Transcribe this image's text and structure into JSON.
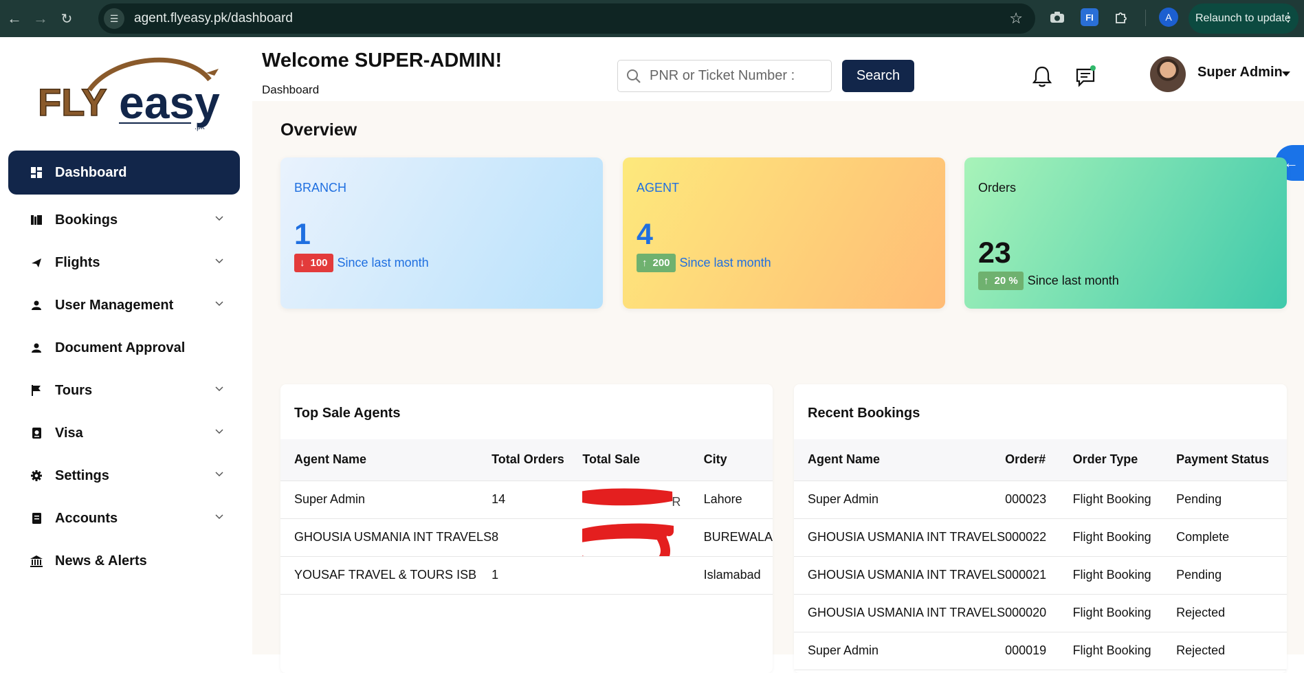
{
  "browser": {
    "url": "agent.flyeasy.pk/dashboard",
    "relaunch_label": "Relaunch to update",
    "profile_initial": "A",
    "extension_label": "FI"
  },
  "sidebar": {
    "logo_text_fly": "FLY",
    "logo_text_easy": "easy",
    "logo_text_tld": ".pk",
    "items": [
      {
        "label": "Dashboard",
        "icon": "dashboard-icon",
        "active": true,
        "expandable": false
      },
      {
        "label": "Bookings",
        "icon": "bookings-icon",
        "expandable": true
      },
      {
        "label": "Flights",
        "icon": "plane-icon",
        "expandable": true
      },
      {
        "label": "User Management",
        "icon": "user-icon",
        "expandable": true
      },
      {
        "label": "Document Approval",
        "icon": "user-icon",
        "expandable": false
      },
      {
        "label": "Tours",
        "icon": "flag-icon",
        "expandable": true
      },
      {
        "label": "Visa",
        "icon": "passport-icon",
        "expandable": true
      },
      {
        "label": "Settings",
        "icon": "gear-icon",
        "expandable": true
      },
      {
        "label": "Accounts",
        "icon": "ledger-icon",
        "expandable": true
      },
      {
        "label": "News & Alerts",
        "icon": "bank-icon",
        "expandable": false
      }
    ]
  },
  "header": {
    "welcome": "Welcome SUPER-ADMIN!",
    "breadcrumb": "Dashboard",
    "search_placeholder": "PNR or Ticket Number :",
    "search_button": "Search",
    "user_name": "Super Admin"
  },
  "overview": {
    "title": "Overview",
    "cards": [
      {
        "label": "BRANCH",
        "value": "1",
        "trend": "down",
        "badge": "100",
        "since": "Since last month"
      },
      {
        "label": "AGENT",
        "value": "4",
        "trend": "up",
        "badge": "200",
        "since": "Since last month"
      },
      {
        "label": "Orders",
        "value": "23",
        "trend": "up",
        "badge": "20 %",
        "since": "Since last month"
      }
    ]
  },
  "top_sale_agents": {
    "title": "Top Sale Agents",
    "columns": [
      "Agent Name",
      "Total Orders",
      "Total Sale",
      "City"
    ],
    "rows": [
      {
        "agent": "Super Admin",
        "orders": "14",
        "sale_suffix": "R",
        "city": "Lahore"
      },
      {
        "agent": "GHOUSIA USMANIA INT TRAVELS",
        "orders": "8",
        "sale_suffix": "",
        "city": "BUREWALA"
      },
      {
        "agent": "YOUSAF TRAVEL & TOURS ISB",
        "orders": "1",
        "sale_suffix": "",
        "city": "Islamabad"
      }
    ]
  },
  "recent_bookings": {
    "title": "Recent Bookings",
    "columns": [
      "Agent Name",
      "Order#",
      "Order Type",
      "Payment Status"
    ],
    "rows": [
      {
        "agent": "Super Admin",
        "order": "000023",
        "type": "Flight Booking",
        "status": "Pending"
      },
      {
        "agent": "GHOUSIA USMANIA INT TRAVELS",
        "order": "000022",
        "type": "Flight Booking",
        "status": "Complete"
      },
      {
        "agent": "GHOUSIA USMANIA INT TRAVELS",
        "order": "000021",
        "type": "Flight Booking",
        "status": "Pending"
      },
      {
        "agent": "GHOUSIA USMANIA INT TRAVELS",
        "order": "000020",
        "type": "Flight Booking",
        "status": "Rejected"
      },
      {
        "agent": "Super Admin",
        "order": "000019",
        "type": "Flight Booking",
        "status": "Rejected"
      }
    ]
  },
  "colors": {
    "brand_navy": "#12264a",
    "accent_blue": "#1f6fe0",
    "badge_down": "#e33b3b",
    "badge_up": "#6fb16f",
    "logo_brown": "#8a5a2b",
    "browser_chrome": "#1f3a37"
  }
}
